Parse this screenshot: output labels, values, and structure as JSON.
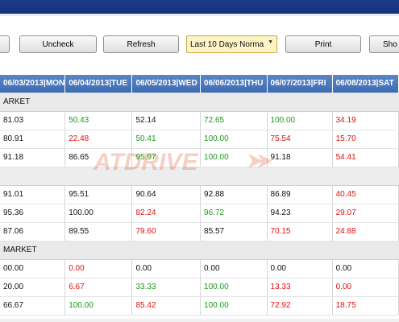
{
  "toolbar": {
    "buttons": {
      "check": "",
      "uncheck": "Uncheck",
      "refresh": "Refresh",
      "print": "Print",
      "show": "Sho"
    },
    "range_select": "Last 10 Days Norma"
  },
  "watermark": "ATDRIVE",
  "colors": {
    "green": "#1a9a1a",
    "red": "#e01010",
    "header_blue": "#4a78bd"
  },
  "table": {
    "columns": [
      "06/03/2013|MON",
      "06/04/2013|TUE",
      "06/05/2013|WED",
      "06/06/2013|THU",
      "06/07/2013|FRI",
      "06/08/2013|SAT"
    ],
    "rows": [
      {
        "type": "group",
        "label": "ARKET"
      },
      {
        "type": "data",
        "cells": [
          {
            "v": "81.03",
            "c": "black"
          },
          {
            "v": "50.43",
            "c": "green"
          },
          {
            "v": "52.14",
            "c": "black"
          },
          {
            "v": "72.65",
            "c": "green"
          },
          {
            "v": "100.00",
            "c": "green"
          },
          {
            "v": "34.19",
            "c": "red"
          }
        ]
      },
      {
        "type": "data",
        "cells": [
          {
            "v": "80.91",
            "c": "black"
          },
          {
            "v": "22.48",
            "c": "red"
          },
          {
            "v": "50.41",
            "c": "green"
          },
          {
            "v": "100.00",
            "c": "green"
          },
          {
            "v": "75.54",
            "c": "red"
          },
          {
            "v": "15.70",
            "c": "red"
          }
        ]
      },
      {
        "type": "data",
        "cells": [
          {
            "v": "91.18",
            "c": "black"
          },
          {
            "v": "86.65",
            "c": "black"
          },
          {
            "v": "95.97",
            "c": "green"
          },
          {
            "v": "100.00",
            "c": "green"
          },
          {
            "v": "91.18",
            "c": "black"
          },
          {
            "v": "54.41",
            "c": "red"
          }
        ]
      },
      {
        "type": "blank",
        "label": ""
      },
      {
        "type": "data",
        "cells": [
          {
            "v": "91.01",
            "c": "black"
          },
          {
            "v": "95.51",
            "c": "black"
          },
          {
            "v": "90.64",
            "c": "black"
          },
          {
            "v": "92.88",
            "c": "black"
          },
          {
            "v": "86.89",
            "c": "black"
          },
          {
            "v": "40.45",
            "c": "red"
          }
        ]
      },
      {
        "type": "data",
        "cells": [
          {
            "v": "95.36",
            "c": "black"
          },
          {
            "v": "100.00",
            "c": "black"
          },
          {
            "v": "82.24",
            "c": "red"
          },
          {
            "v": "96.72",
            "c": "green"
          },
          {
            "v": "94.23",
            "c": "black"
          },
          {
            "v": "29.07",
            "c": "red"
          }
        ]
      },
      {
        "type": "data",
        "cells": [
          {
            "v": "87.06",
            "c": "black"
          },
          {
            "v": "89.55",
            "c": "black"
          },
          {
            "v": "79.60",
            "c": "red"
          },
          {
            "v": "85.57",
            "c": "black"
          },
          {
            "v": "70.15",
            "c": "red"
          },
          {
            "v": "24.88",
            "c": "red"
          }
        ]
      },
      {
        "type": "group",
        "label": "MARKET"
      },
      {
        "type": "data",
        "cells": [
          {
            "v": "00.00",
            "c": "black"
          },
          {
            "v": "0.00",
            "c": "red"
          },
          {
            "v": "0.00",
            "c": "black"
          },
          {
            "v": "0.00",
            "c": "black"
          },
          {
            "v": "0.00",
            "c": "black"
          },
          {
            "v": "0.00",
            "c": "black"
          }
        ]
      },
      {
        "type": "data",
        "cells": [
          {
            "v": "20.00",
            "c": "black"
          },
          {
            "v": "6.67",
            "c": "red"
          },
          {
            "v": "33.33",
            "c": "green"
          },
          {
            "v": "100.00",
            "c": "green"
          },
          {
            "v": "13.33",
            "c": "red"
          },
          {
            "v": "0.00",
            "c": "red"
          }
        ]
      },
      {
        "type": "data",
        "cells": [
          {
            "v": "66.67",
            "c": "black"
          },
          {
            "v": "100.00",
            "c": "green"
          },
          {
            "v": "85.42",
            "c": "red"
          },
          {
            "v": "100.00",
            "c": "green"
          },
          {
            "v": "72.92",
            "c": "red"
          },
          {
            "v": "18.75",
            "c": "red"
          }
        ]
      }
    ]
  }
}
